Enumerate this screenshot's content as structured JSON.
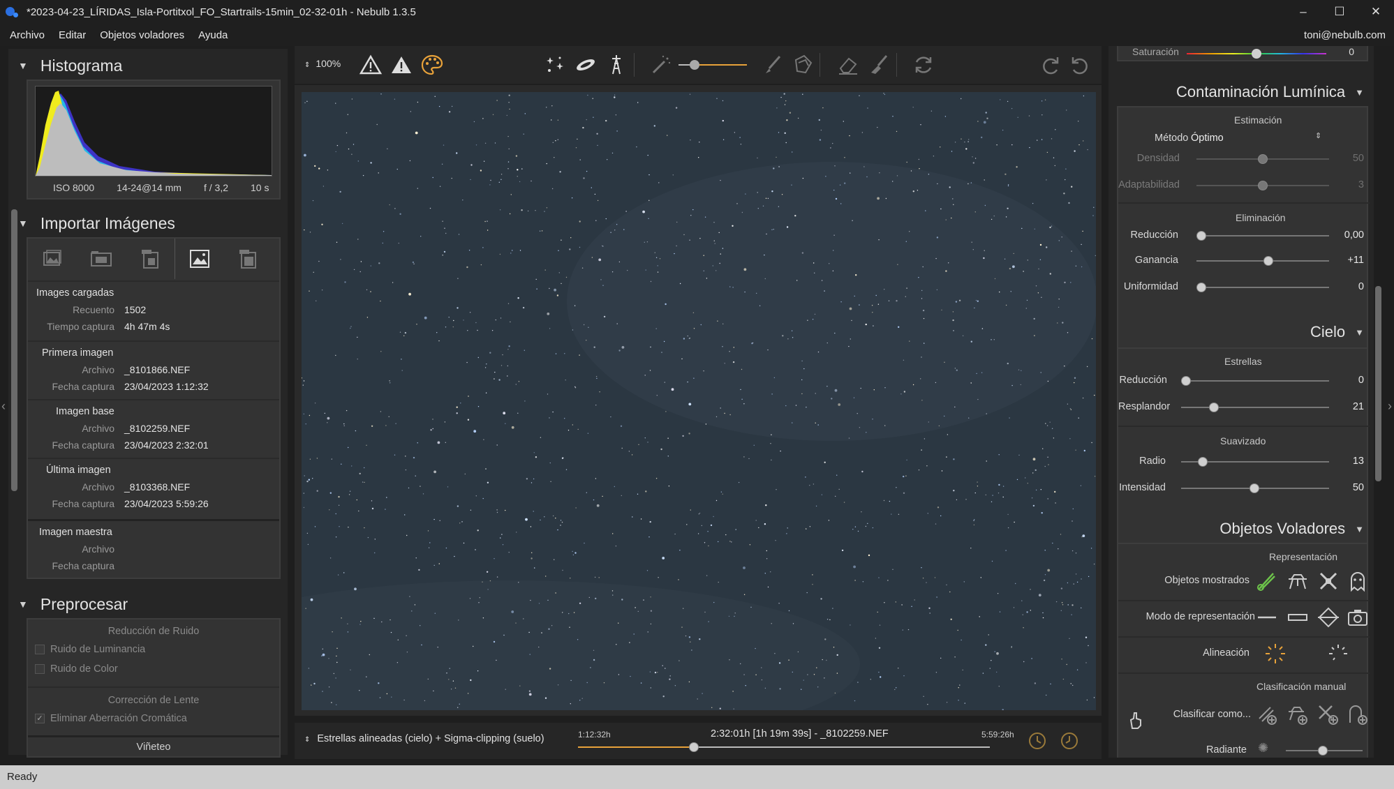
{
  "window": {
    "title": "*2023-04-23_LÍRIDAS_Isla-Portitxol_FO_Startrails-15min_02-32-01h - Nebulb 1.3.5",
    "minimize": "–",
    "maximize": "☐",
    "close": "✕"
  },
  "menu": {
    "items": [
      "Archivo",
      "Editar",
      "Objetos voladores",
      "Ayuda"
    ],
    "user": "toni@nebulb.com"
  },
  "histogram": {
    "title": "Histograma",
    "iso": "ISO 8000",
    "lens": "14-24@14 mm",
    "aperture": "f / 3,2",
    "exposure": "10 s"
  },
  "import": {
    "title": "Importar Imágenes",
    "icons": [
      "add-images-icon",
      "add-folder-icon",
      "remove-images-icon",
      "set-base-image-icon",
      "remove-all-icon"
    ],
    "loaded": {
      "title": "Images cargadas",
      "count_label": "Recuento",
      "count": "1502",
      "time_label": "Tiempo captura",
      "time": "4h 47m 4s"
    },
    "first": {
      "title": "Primera imagen",
      "file_label": "Archivo",
      "file": "_8101866.NEF",
      "date_label": "Fecha captura",
      "date": "23/04/2023 1:12:32"
    },
    "base": {
      "title": "Imagen base",
      "file_label": "Archivo",
      "file": "_8102259.NEF",
      "date_label": "Fecha captura",
      "date": "23/04/2023 2:32:01"
    },
    "last": {
      "title": "Última imagen",
      "file_label": "Archivo",
      "file": "_8103368.NEF",
      "date_label": "Fecha captura",
      "date": "23/04/2023 5:59:26"
    },
    "master": {
      "title": "Imagen maestra",
      "file_label": "Archivo",
      "date_label": "Fecha captura"
    }
  },
  "preprocess": {
    "title": "Preprocesar",
    "noise_title": "Reducción de Ruido",
    "luminance": "Ruido de Luminancia",
    "color": "Ruido de Color",
    "lens_title": "Corrección de Lente",
    "chromatic": "Eliminar Aberración Cromática",
    "vignette": "Viñeteo"
  },
  "toolbar": {
    "zoom": "100%"
  },
  "bottom": {
    "mode": "Estrellas alineadas (cielo) + Sigma-clipping (suelo)",
    "start": "1:12:32h",
    "current": "2:32:01h [1h 19m 39s] - _8102259.NEF",
    "end": "5:59:26h",
    "progress": 0.281
  },
  "right": {
    "saturacion_label": "Saturación",
    "saturacion_value": "0",
    "lp": {
      "title": "Contaminación Lumínica",
      "estimation": "Estimación",
      "method_label": "Método",
      "method_value": "Óptimo",
      "density_label": "Densidad",
      "density_value": "50",
      "adapt_label": "Adaptabilidad",
      "adapt_value": "3",
      "elimination": "Eliminación",
      "reduction_label": "Reducción",
      "reduction_value": "0,00",
      "gain_label": "Ganancia",
      "gain_value": "+11",
      "uniform_label": "Uniformidad",
      "uniform_value": "0"
    },
    "sky": {
      "title": "Cielo",
      "stars": "Estrellas",
      "reduction_label": "Reducción",
      "reduction_value": "0",
      "glow_label": "Resplandor",
      "glow_value": "21",
      "smooth": "Suavizado",
      "radius_label": "Radio",
      "radius_value": "13",
      "intensity_label": "Intensidad",
      "intensity_value": "50"
    },
    "flying": {
      "title": "Objetos Voladores",
      "representation": "Representación",
      "shown_label": "Objetos mostrados",
      "mode_label": "Modo de representación",
      "align_label": "Alineación",
      "manual": "Clasificación manual",
      "classify_label": "Clasificar como...",
      "radiant_label": "Radiante"
    }
  },
  "status": "Ready",
  "colors": {
    "accent": "#e8a23a",
    "sky": "#2b3742",
    "meteor_green": "#6cc24a"
  }
}
